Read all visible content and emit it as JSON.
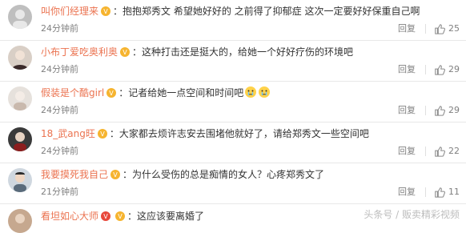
{
  "comments": [
    {
      "username": "叫你们经理来",
      "text": "：抱抱郑秀文 希望她好好的 之前得了抑郁症 这次一定要好好保重自己啊",
      "time": "24分钟前",
      "reply": "回复",
      "likes": "25"
    },
    {
      "username": "小布丁爱吃奥利奥",
      "text": "：这种打击还是挺大的，给她一个好好疗伤的环境吧",
      "time": "24分钟前",
      "reply": "回复",
      "likes": "29"
    },
    {
      "username": "假装是个酷girl",
      "text": "：记者给她一点空间和时间吧",
      "time": "24分钟前",
      "reply": "回复",
      "likes": "29"
    },
    {
      "username": "18_武ang旺",
      "text": "：大家都去烦许志安去围堵他就好了，请给郑秀文一些空间吧",
      "time": "24分钟前",
      "reply": "回复",
      "likes": "22"
    },
    {
      "username": "我要摸死我自己",
      "text": "：为什么受伤的总是痴情的女人？心疼郑秀文了",
      "time": "21分钟前",
      "reply": "回复",
      "likes": "11"
    },
    {
      "username": "看坦如心大师",
      "text": "：这应该要离婚了",
      "time": "",
      "reply": "",
      "likes": ""
    }
  ],
  "watermark": "头条号 / 贩卖精彩视频",
  "colors": {
    "username": "#eb7350",
    "text": "#333333",
    "meta": "#808080",
    "divider": "#e8e8e8"
  }
}
